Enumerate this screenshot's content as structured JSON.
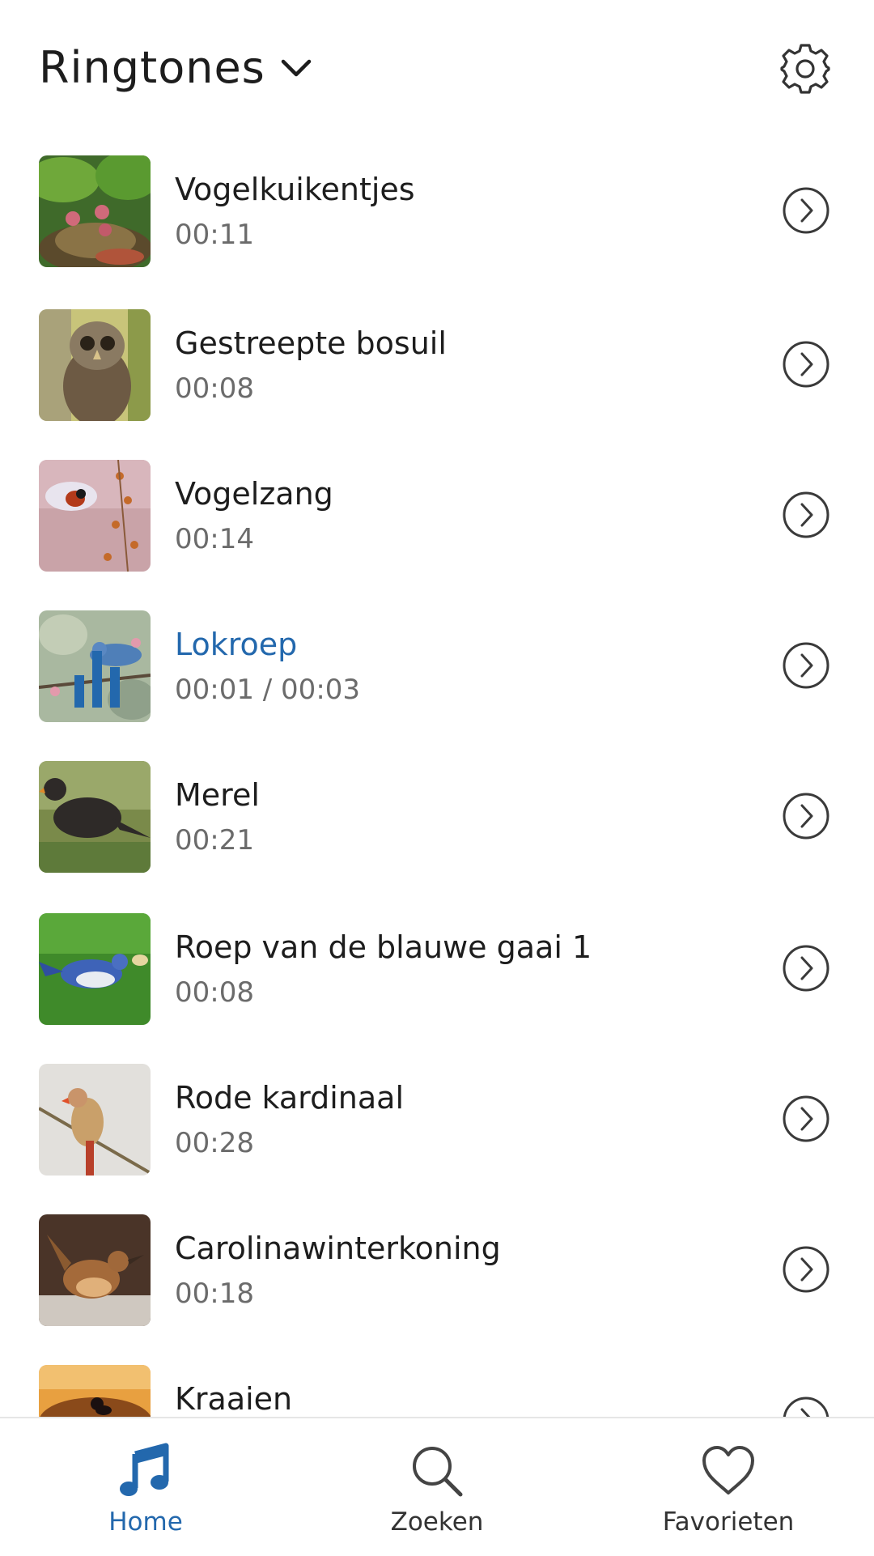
{
  "header": {
    "title": "Ringtones",
    "dropdown_icon": "chevron-down-icon",
    "settings_icon": "gear-icon"
  },
  "list": {
    "items": [
      {
        "name": "Vogelkuikentjes",
        "duration": "00:11",
        "thumb": "bird-chicks-nest"
      },
      {
        "name": "Gestreepte bosuil",
        "duration": "00:08",
        "thumb": "barred-owl"
      },
      {
        "name": "Vogelzang",
        "duration": "00:14",
        "thumb": "hummingbird-flowers"
      },
      {
        "name": "Lokroep",
        "duration": "00:01 / 00:03",
        "thumb": "blue-bird-branch",
        "playing": true
      },
      {
        "name": "Merel",
        "duration": "00:21",
        "thumb": "blackbird-grass"
      },
      {
        "name": "Roep van de blauwe gaai 1",
        "duration": "00:08",
        "thumb": "blue-jay-grass"
      },
      {
        "name": "Rode kardinaal",
        "duration": "00:28",
        "thumb": "female-cardinal"
      },
      {
        "name": "Carolinawinterkoning",
        "duration": "00:18",
        "thumb": "carolina-wren"
      },
      {
        "name": "Kraaien",
        "duration": "",
        "thumb": "crows-sunset"
      }
    ]
  },
  "bottom_nav": {
    "home": "Home",
    "search": "Zoeken",
    "favorites": "Favorieten"
  },
  "colors": {
    "accent": "#2368ad",
    "text": "#1d1d1d",
    "muted": "#6b6b6b"
  }
}
